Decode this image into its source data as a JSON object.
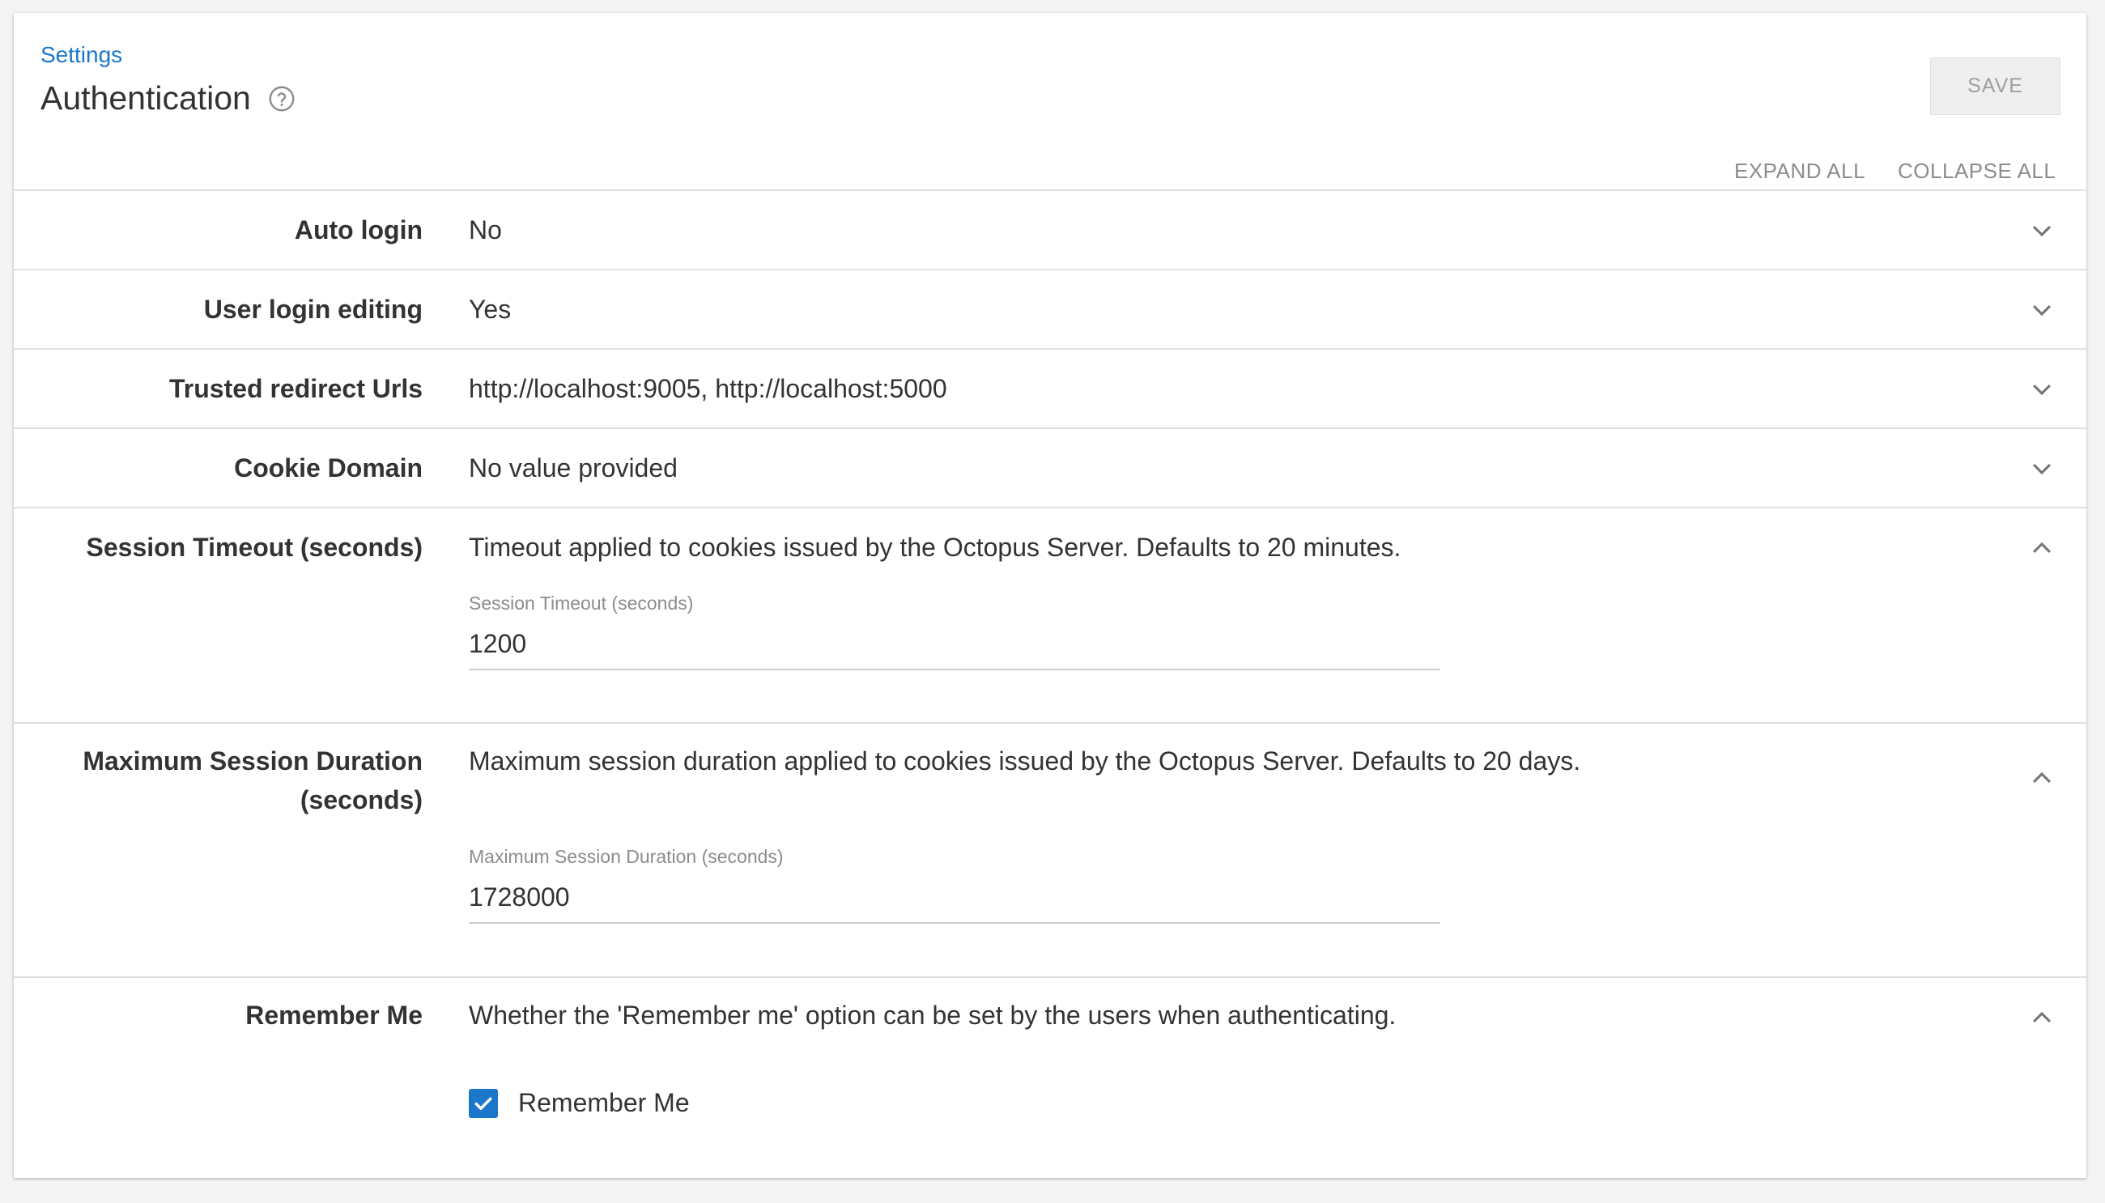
{
  "header": {
    "breadcrumb": "Settings",
    "title": "Authentication",
    "save_label": "SAVE",
    "expand_all_label": "EXPAND ALL",
    "collapse_all_label": "COLLAPSE ALL"
  },
  "settings": [
    {
      "label": "Auto login",
      "summary": "No",
      "expanded": false
    },
    {
      "label": "User login editing",
      "summary": "Yes",
      "expanded": false
    },
    {
      "label": "Trusted redirect Urls",
      "summary": "http://localhost:9005, http://localhost:5000",
      "expanded": false
    },
    {
      "label": "Cookie Domain",
      "summary": "No value provided",
      "expanded": false
    },
    {
      "label": "Session Timeout (seconds)",
      "summary": "Timeout applied to cookies issued by the Octopus Server. Defaults to 20 minutes.",
      "expanded": true,
      "field_label": "Session Timeout (seconds)",
      "field_value": "1200"
    },
    {
      "label": "Maximum Session Duration (seconds)",
      "summary": "Maximum session duration applied to cookies issued by the Octopus Server. Defaults to 20 days.",
      "expanded": true,
      "field_label": "Maximum Session Duration (seconds)",
      "field_value": "1728000"
    },
    {
      "label": "Remember Me",
      "summary": "Whether the 'Remember me' option can be set by the users when authenticating.",
      "expanded": true,
      "checkbox_label": "Remember Me",
      "checkbox_checked": true
    }
  ],
  "colors": {
    "accent": "#1a77ca",
    "text": "#333333",
    "muted": "#8c8c8c",
    "divider": "#e0e0e0"
  }
}
